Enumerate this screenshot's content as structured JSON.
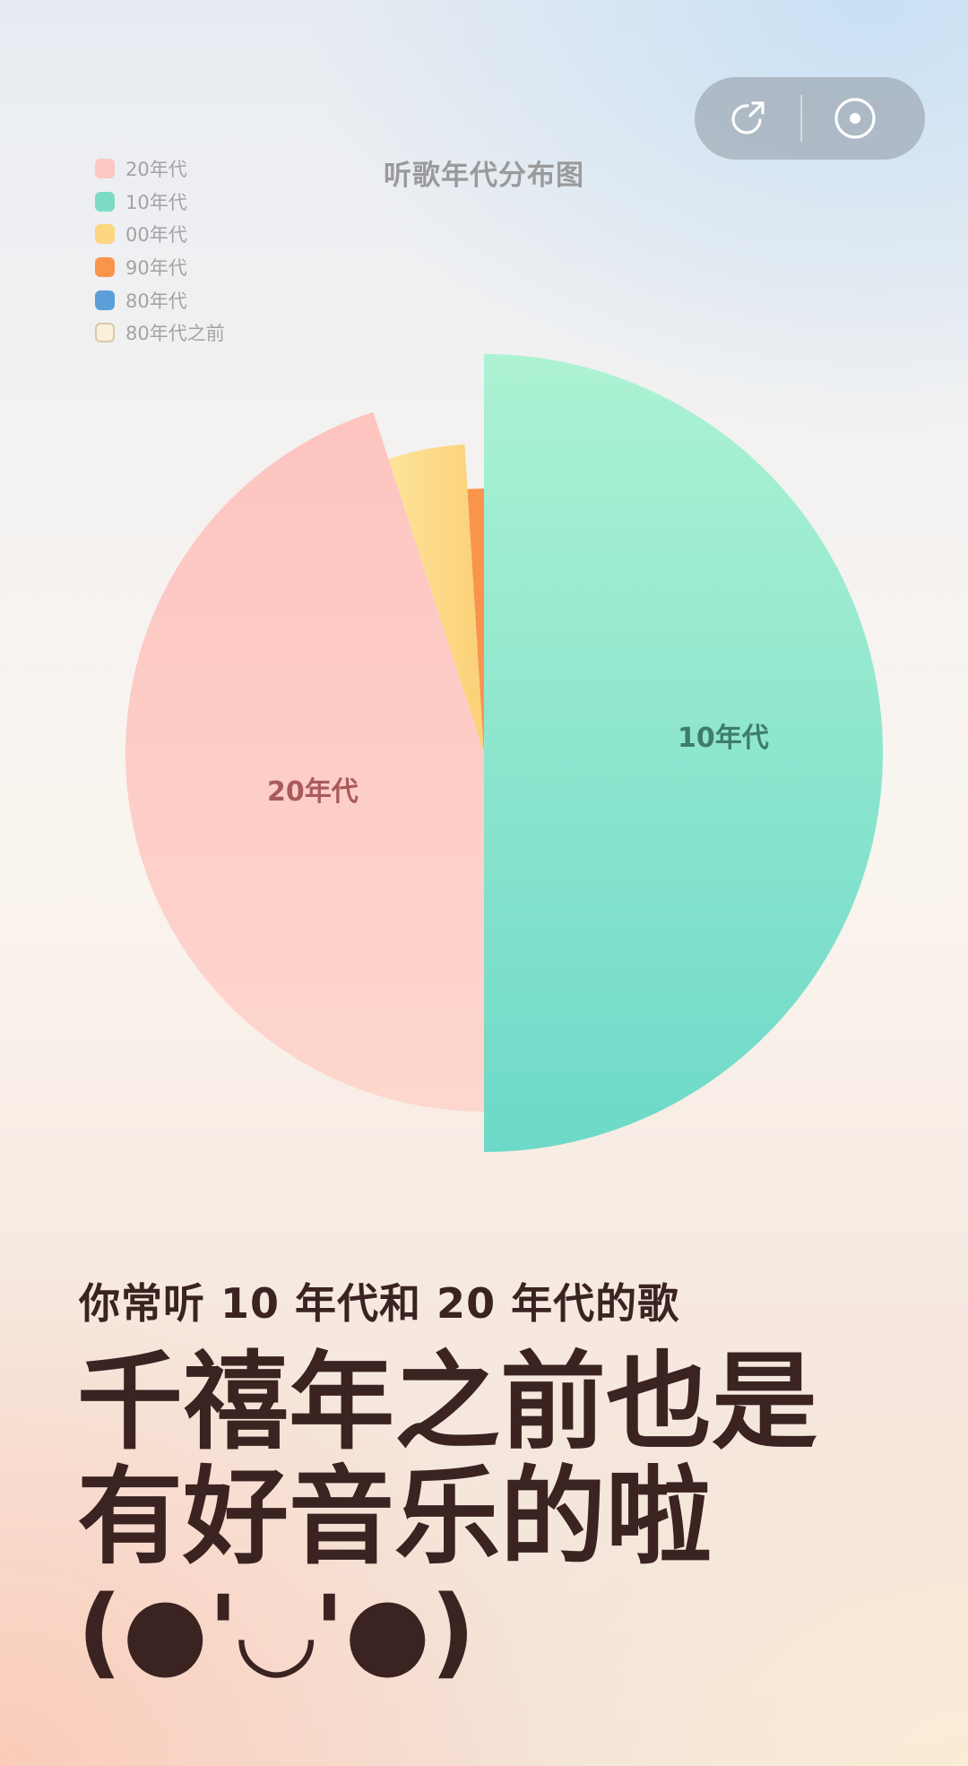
{
  "controls": {
    "share_icon": "share-arrow-icon",
    "disc_icon": "disc-icon"
  },
  "chart_data": {
    "type": "pie",
    "title": "听歌年代分布图",
    "legend_position": "top-left",
    "categories": [
      "20年代",
      "10年代",
      "00年代",
      "90年代",
      "80年代",
      "80年代之前"
    ],
    "values": [
      45,
      50,
      4,
      1,
      0,
      0
    ],
    "colors": [
      "#fdc7c2",
      "#7ddbc5",
      "#fdd681",
      "#f9944c",
      "#5b9fd8",
      "#fbf0dc"
    ],
    "slice_labels": [
      "20年代",
      "10年代"
    ]
  },
  "text": {
    "subtitle": "你常听 10 年代和 20 年代的歌",
    "headline_line1": "千禧年之前也是",
    "headline_line2": "有好音乐的啦",
    "headline_line3": "(●'◡'●)"
  }
}
